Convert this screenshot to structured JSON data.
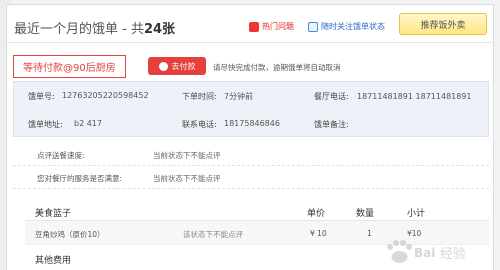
{
  "header": {
    "title_prefix": "最近一个月的饿单 - 共",
    "title_count": "24张",
    "links": [
      {
        "label": "热门问题",
        "icon": "hot-icon"
      },
      {
        "label": "随时关注饿单状态",
        "icon": "phone-icon"
      }
    ],
    "share_label": "推荐饭外卖"
  },
  "status": {
    "badge": "等待付款@90后厨房",
    "pay_button": "去付款",
    "note": "请尽快完成付款，逾期饿单将自动取消"
  },
  "info": {
    "order_no_label": "饿单号:",
    "order_no": "12763205220598452",
    "order_time_label": "下单时间:",
    "order_time": "7分钟前",
    "restaurant_phone_label": "餐厅电话:",
    "restaurant_phone": "18711481891 18711481891",
    "address_label": "饿单地址:",
    "address": "b2 417",
    "contact_phone_label": "联系电话:",
    "contact_phone": "18175846846",
    "remark_label": "饿单备注:"
  },
  "review": [
    {
      "label": "点评送餐速度:",
      "value": "当前状态下不能点评"
    },
    {
      "label": "您对餐厅的服务是否满意:",
      "value": "当前状态下不能点评"
    }
  ],
  "table": {
    "headers": [
      "美食篮子",
      "单价",
      "数量",
      "小计"
    ],
    "rows": [
      {
        "name": "豆角炒鸡（原价10）",
        "note": "该状态下不能点评",
        "price": "¥ 10",
        "qty": "1",
        "subtotal": "¥10"
      }
    ],
    "other_label": "其他费用"
  },
  "watermark": "Baidu 经验"
}
